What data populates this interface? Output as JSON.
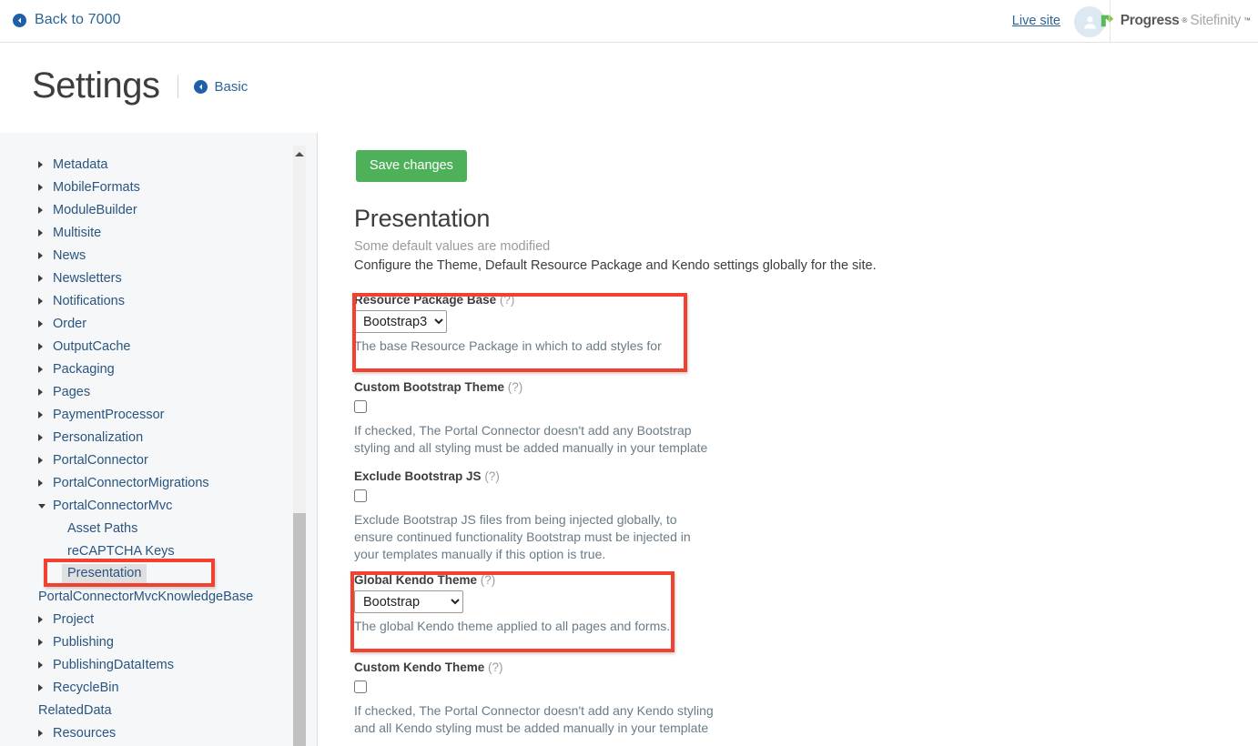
{
  "topbar": {
    "back_label": "Back to 7000",
    "back_icon": "circle-left-arrow-icon",
    "live_site_label": "Live site",
    "avatar_icon": "user-avatar-icon",
    "brand": {
      "logo_icon": "progress-arrow-logo",
      "progress": "Progress",
      "tm": "®",
      "sitefinity": "Sitefinity",
      "sitefinity_tm": "™"
    }
  },
  "page": {
    "title": "Settings",
    "breadcrumb_label": "Basic",
    "breadcrumb_icon": "circle-left-arrow-icon"
  },
  "sidebar": {
    "scroll_up_icon": "scroll-up-arrow-icon",
    "items": [
      {
        "label": "Metadata",
        "caret": true,
        "level": 0,
        "selected": false
      },
      {
        "label": "MobileFormats",
        "caret": true,
        "level": 0,
        "selected": false
      },
      {
        "label": "ModuleBuilder",
        "caret": true,
        "level": 0,
        "selected": false
      },
      {
        "label": "Multisite",
        "caret": true,
        "level": 0,
        "selected": false
      },
      {
        "label": "News",
        "caret": true,
        "level": 0,
        "selected": false
      },
      {
        "label": "Newsletters",
        "caret": true,
        "level": 0,
        "selected": false
      },
      {
        "label": "Notifications",
        "caret": true,
        "level": 0,
        "selected": false
      },
      {
        "label": "Order",
        "caret": true,
        "level": 0,
        "selected": false
      },
      {
        "label": "OutputCache",
        "caret": true,
        "level": 0,
        "selected": false
      },
      {
        "label": "Packaging",
        "caret": true,
        "level": 0,
        "selected": false
      },
      {
        "label": "Pages",
        "caret": true,
        "level": 0,
        "selected": false
      },
      {
        "label": "PaymentProcessor",
        "caret": true,
        "level": 0,
        "selected": false
      },
      {
        "label": "Personalization",
        "caret": true,
        "level": 0,
        "selected": false
      },
      {
        "label": "PortalConnector",
        "caret": true,
        "level": 0,
        "selected": false
      },
      {
        "label": "PortalConnectorMigrations",
        "caret": true,
        "level": 0,
        "selected": false
      },
      {
        "label": "PortalConnectorMvc",
        "caret": true,
        "expanded": true,
        "level": 0,
        "selected": false
      },
      {
        "label": "Asset Paths",
        "caret": false,
        "level": 1,
        "selected": false
      },
      {
        "label": "reCAPTCHA Keys",
        "caret": false,
        "level": 1,
        "selected": false
      },
      {
        "label": "Presentation",
        "caret": false,
        "level": 1,
        "selected": true
      },
      {
        "label": "PortalConnectorMvcKnowledgeBase",
        "caret": false,
        "level": 0,
        "selected": false
      },
      {
        "label": "Project",
        "caret": true,
        "level": 0,
        "selected": false
      },
      {
        "label": "Publishing",
        "caret": true,
        "level": 0,
        "selected": false
      },
      {
        "label": "PublishingDataItems",
        "caret": true,
        "level": 0,
        "selected": false
      },
      {
        "label": "RecycleBin",
        "caret": true,
        "level": 0,
        "selected": false
      },
      {
        "label": "RelatedData",
        "caret": false,
        "level": 0,
        "selected": false
      },
      {
        "label": "Resources",
        "caret": true,
        "level": 0,
        "selected": false
      }
    ]
  },
  "main": {
    "save_label": "Save changes",
    "section_title": "Presentation",
    "section_subtitle": "Some default values are modified",
    "section_description": "Configure the Theme, Default Resource Package and Kendo settings globally for the site.",
    "fields": [
      {
        "label": "Resource Package Base",
        "hint": "(?)",
        "type": "select",
        "value": "Bootstrap3",
        "options": [
          "Bootstrap3"
        ],
        "help": "The base Resource Package in which to add styles for",
        "highlighted": true
      },
      {
        "label": "Custom Bootstrap Theme",
        "hint": "(?)",
        "type": "checkbox",
        "checked": false,
        "help": "If checked, The Portal Connector doesn't add any Bootstrap styling and all styling must be added manually in your template",
        "highlighted": false
      },
      {
        "label": "Exclude Bootstrap JS",
        "hint": "(?)",
        "type": "checkbox",
        "checked": false,
        "help": "Exclude Bootstrap JS files from being injected globally, to ensure continued functionality Bootstrap must be injected in your templates manually if this option is true.",
        "highlighted": false
      },
      {
        "label": "Global Kendo Theme",
        "hint": "(?)",
        "type": "select",
        "value": "Bootstrap",
        "options": [
          "Bootstrap"
        ],
        "help": "The global Kendo theme applied to all pages and forms.",
        "highlighted": true
      },
      {
        "label": "Custom Kendo Theme",
        "hint": "(?)",
        "type": "checkbox",
        "checked": false,
        "help": "If checked, The Portal Connector doesn't add any Kendo styling and all Kendo styling must be added manually in your template",
        "highlighted": false
      }
    ]
  },
  "colors": {
    "accent_green": "#4fb05a",
    "link_blue": "#2a6496",
    "highlight_red": "#f4402f",
    "sidebar_bg": "#f5f7f9"
  }
}
